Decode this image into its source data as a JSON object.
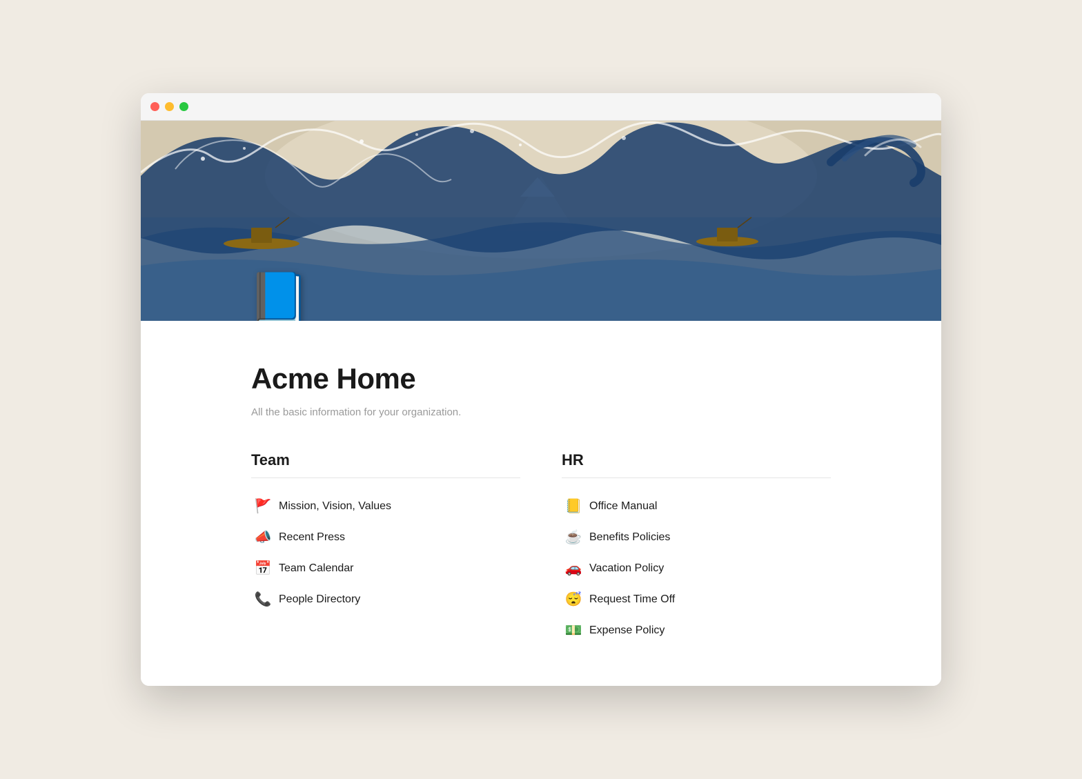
{
  "window": {
    "traffic_lights": [
      "close",
      "minimize",
      "maximize"
    ]
  },
  "header": {
    "book_emoji": "📘"
  },
  "page": {
    "title": "Acme Home",
    "subtitle": "All the basic information for your organization."
  },
  "team_section": {
    "heading": "Team",
    "items": [
      {
        "icon": "🚩",
        "label": "Mission, Vision, Values"
      },
      {
        "icon": "📣",
        "label": "Recent Press"
      },
      {
        "icon": "📅",
        "label": "Team Calendar"
      },
      {
        "icon": "📞",
        "label": "People Directory"
      }
    ]
  },
  "hr_section": {
    "heading": "HR",
    "items": [
      {
        "icon": "📒",
        "label": "Office Manual"
      },
      {
        "icon": "☕",
        "label": "Benefits Policies"
      },
      {
        "icon": "🚗",
        "label": "Vacation Policy"
      },
      {
        "icon": "😴",
        "label": "Request Time Off"
      },
      {
        "icon": "💵",
        "label": "Expense Policy"
      }
    ]
  }
}
